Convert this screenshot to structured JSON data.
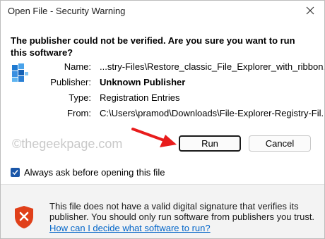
{
  "window": {
    "title": "Open File - Security Warning"
  },
  "question": "The publisher could not be verified.  Are you sure you want to run this software?",
  "details": {
    "name_label": "Name:",
    "name_value": "...stry-Files\\Restore_classic_File_Explorer_with_ribbon.reg",
    "publisher_label": "Publisher:",
    "publisher_value": "Unknown Publisher",
    "type_label": "Type:",
    "type_value": "Registration Entries",
    "from_label": "From:",
    "from_value": "C:\\Users\\pramod\\Downloads\\File-Explorer-Registry-Fil..."
  },
  "watermark": "©thegeekpage.com",
  "buttons": {
    "run": "Run",
    "cancel": "Cancel"
  },
  "checkbox": {
    "label": "Always ask before opening this file",
    "checked": true
  },
  "warning": {
    "text": "This file does not have a valid digital signature that verifies its publisher.  You should only run software from publishers you trust.",
    "link": "How can I decide what software to run?"
  },
  "icons": {
    "close": "close-icon",
    "file": "registry-file-icon",
    "shield": "warning-shield-icon",
    "arrow": "red-arrow-annotation"
  },
  "colors": {
    "accent": "#1a56a8",
    "link": "#0064c8",
    "shield": "#e0401a",
    "arrow": "#e81c1c"
  }
}
